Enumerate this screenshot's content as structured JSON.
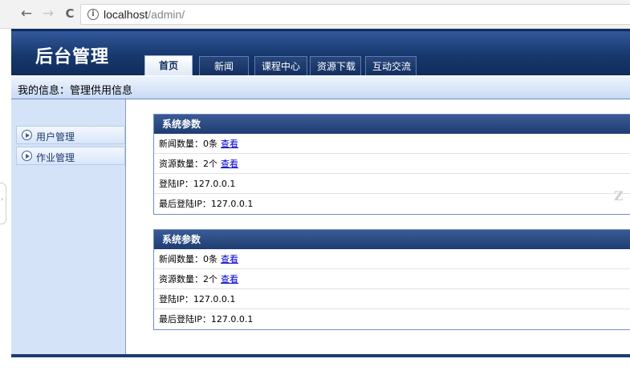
{
  "browser": {
    "back_icon": "←",
    "forward_icon": "→",
    "reload_icon": "C",
    "info_icon": "i",
    "url_host": "localhost",
    "url_path": "/admin/"
  },
  "header": {
    "title": "后台管理",
    "tabs": [
      {
        "label": "首页",
        "active": true
      },
      {
        "label": "新闻",
        "active": false
      },
      {
        "label": "课程中心",
        "active": false
      },
      {
        "label": "资源下载",
        "active": false
      },
      {
        "label": "互动交流",
        "active": false
      }
    ]
  },
  "info_bar": {
    "text": "我的信息：管理供用信息"
  },
  "sidebar": {
    "items": [
      {
        "label": "用户管理"
      },
      {
        "label": "作业管理"
      }
    ]
  },
  "panels": [
    {
      "title": "系统参数",
      "news_count": "新闻数量：0条",
      "news_link": "查看",
      "res_count": "资源数量：2个",
      "res_link": "查看",
      "login_ip": "登陆IP：127.0.0.1",
      "last_login_ip": "最后登陆IP：127.0.0.1"
    },
    {
      "title": "系统参数",
      "news_count": "新闻数量：0条",
      "news_link": "查看",
      "res_count": "资源数量：2个",
      "res_link": "查看",
      "login_ip": "登陆IP：127.0.0.1",
      "last_login_ip": "最后登陆IP：127.0.0.1"
    }
  ],
  "watermark": "Z",
  "colors": {
    "header_dark": "#17386d",
    "sidebar_bg": "#d5e3f8",
    "link": "#0000cc"
  }
}
